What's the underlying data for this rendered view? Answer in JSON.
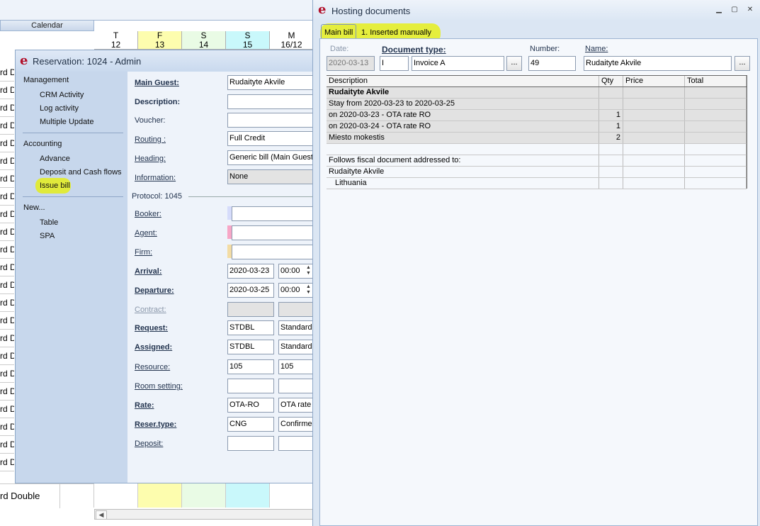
{
  "calendar": {
    "label": "Calendar",
    "days": [
      {
        "dow": "T",
        "num": "12",
        "color": "#ffffff"
      },
      {
        "dow": "F",
        "num": "13",
        "color": "#fdfdae"
      },
      {
        "dow": "S",
        "num": "14",
        "color": "#e9fbe5"
      },
      {
        "dow": "S",
        "num": "15",
        "color": "#c9f8fb"
      },
      {
        "dow": "M",
        "num": "16/12",
        "color": "#ffffff"
      }
    ],
    "row_labels": [
      "rd D",
      "rd D",
      "rd D",
      "rd D",
      "rd D",
      "rd D",
      "rd D",
      "rd D",
      "rd D",
      "rd D",
      "rd D",
      "rd D",
      "rd D",
      "rd D",
      "rd D",
      "rd D",
      "rd D",
      "rd D",
      "rd D",
      "rd D",
      "rd D",
      "rd D",
      "rd D"
    ],
    "bottom_label": "rd Double"
  },
  "reservation": {
    "title": "Reservation: 1024 - Admin",
    "sidebar": {
      "management_heading": "Management",
      "management_items": [
        "CRM Activity",
        "Log activity",
        "Multiple Update"
      ],
      "accounting_heading": "Accounting",
      "accounting_items": [
        "Advance",
        "Deposit and Cash flows",
        "Issue bill"
      ],
      "new_heading": "New...",
      "new_items": [
        "Table",
        "SPA"
      ]
    },
    "form": {
      "main_guest_label": "Main Guest:",
      "main_guest_value": "Rudaityte Akvile",
      "description_label": "Description:",
      "voucher_label": "Voucher:",
      "routing_label": "Routing :",
      "routing_value": "Full Credit",
      "heading_label": "Heading:",
      "heading_value": "Generic bill (Main Guest)",
      "information_label": "Information:",
      "information_value": "None",
      "protocol_label": "Protocol: 1045",
      "booker_label": "Booker:",
      "agent_label": "Agent:",
      "firm_label": "Firm:",
      "arrival_label": "Arrival:",
      "arrival_date": "2020-03-23",
      "arrival_time": "00:00",
      "departure_label": "Departure:",
      "departure_date": "2020-03-25",
      "departure_time": "00:00",
      "contract_label": "Contract:",
      "request_label": "Request:",
      "request_code": "STDBL",
      "request_name": "Standard",
      "assigned_label": "Assigned:",
      "assigned_code": "STDBL",
      "assigned_name": "Standard",
      "resource_label": "Resource:",
      "resource_code": "105",
      "resource_name": "105",
      "room_setting_label": "Room setting:",
      "rate_label": "Rate:",
      "rate_code": "OTA-RO",
      "rate_name": "OTA rate",
      "reser_type_label": "Reser.type:",
      "reser_type_code": "CNG",
      "reser_type_name": "Confirmed",
      "deposit_label": "Deposit:"
    }
  },
  "hosting": {
    "title": "Hosting documents",
    "tabs": [
      "Main bill",
      "1. Inserted manually"
    ],
    "date_label": "Date:",
    "date_value": "2020-03-13",
    "doctype_label": "Document type:",
    "doctype_code": "I",
    "doctype_name": "Invoice A",
    "number_label": "Number:",
    "number_value": "49",
    "name_label": "Name:",
    "name_value": "Rudaityte Akvile",
    "dots": "...",
    "columns": [
      "Description",
      "Qty",
      "Price",
      "Total"
    ],
    "rows": [
      {
        "desc": "Rudaityte Akvile",
        "qty": "",
        "shade": true,
        "bold": true,
        "indent": false
      },
      {
        "desc": "Stay from 2020-03-23 to 2020-03-25",
        "qty": "",
        "shade": true,
        "bold": false,
        "indent": false
      },
      {
        "desc": "on 2020-03-23 - OTA rate RO",
        "qty": "1",
        "shade": true,
        "bold": false,
        "indent": false
      },
      {
        "desc": "on 2020-03-24 - OTA rate RO",
        "qty": "1",
        "shade": true,
        "bold": false,
        "indent": false
      },
      {
        "desc": "Miesto mokestis",
        "qty": "2",
        "shade": true,
        "bold": false,
        "indent": false
      },
      {
        "desc": "",
        "qty": "",
        "shade": false,
        "bold": false,
        "indent": false
      },
      {
        "desc": "Follows fiscal document addressed to:",
        "qty": "",
        "shade": false,
        "bold": false,
        "indent": false
      },
      {
        "desc": "Rudaityte Akvile",
        "qty": "",
        "shade": false,
        "bold": false,
        "indent": false
      },
      {
        "desc": "Lithuania",
        "qty": "",
        "shade": false,
        "bold": false,
        "indent": true
      }
    ]
  },
  "colors": {
    "accent_highlight": "#e8f000",
    "logo_red": "#b2102a",
    "booker_marker": "#d6dcfb",
    "agent_marker": "#f7a6c6",
    "firm_marker": "#f3dca4"
  }
}
